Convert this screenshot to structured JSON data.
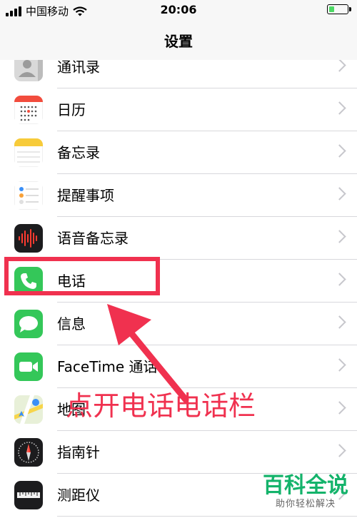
{
  "status_bar": {
    "carrier": "中国移动",
    "time": "20:06",
    "battery_level": 0.3
  },
  "nav": {
    "title": "设置"
  },
  "rows": [
    {
      "label": "通讯录",
      "icon": "contacts-icon"
    },
    {
      "label": "日历",
      "icon": "calendar-icon"
    },
    {
      "label": "备忘录",
      "icon": "notes-icon"
    },
    {
      "label": "提醒事项",
      "icon": "reminders-icon"
    },
    {
      "label": "语音备忘录",
      "icon": "voice-memos-icon"
    },
    {
      "label": "电话",
      "icon": "phone-icon"
    },
    {
      "label": "信息",
      "icon": "messages-icon"
    },
    {
      "label": "FaceTime 通话",
      "icon": "facetime-icon"
    },
    {
      "label": "地图",
      "icon": "maps-icon"
    },
    {
      "label": "指南针",
      "icon": "compass-icon"
    },
    {
      "label": "测距仪",
      "icon": "measure-icon"
    }
  ],
  "annotation": {
    "text": "点开电话电话栏",
    "color": "#f0314f"
  },
  "watermark": {
    "title": "百科全说",
    "subtitle": "助你轻松解决"
  },
  "colors": {
    "accent_green": "#4cd964",
    "separator": "#d8d8dc",
    "chevron": "#c7c7cc"
  }
}
